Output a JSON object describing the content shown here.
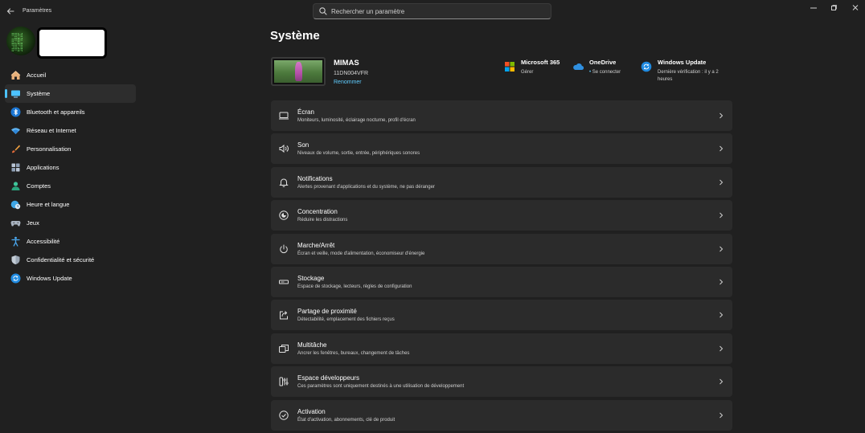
{
  "app": {
    "title": "Paramètres"
  },
  "search": {
    "placeholder": "Rechercher un paramètre"
  },
  "nav": {
    "items": [
      {
        "label": "Accueil",
        "icon": "home-icon",
        "active": false
      },
      {
        "label": "Système",
        "icon": "monitor-icon",
        "active": true
      },
      {
        "label": "Bluetooth et appareils",
        "icon": "bluetooth-icon",
        "active": false
      },
      {
        "label": "Réseau et Internet",
        "icon": "wifi-icon",
        "active": false
      },
      {
        "label": "Personnalisation",
        "icon": "brush-icon",
        "active": false
      },
      {
        "label": "Applications",
        "icon": "apps-icon",
        "active": false
      },
      {
        "label": "Comptes",
        "icon": "person-icon",
        "active": false
      },
      {
        "label": "Heure et langue",
        "icon": "globe-clock-icon",
        "active": false
      },
      {
        "label": "Jeux",
        "icon": "gamepad-icon",
        "active": false
      },
      {
        "label": "Accessibilité",
        "icon": "accessibility-icon",
        "active": false
      },
      {
        "label": "Confidentialité et sécurité",
        "icon": "shield-icon",
        "active": false
      },
      {
        "label": "Windows Update",
        "icon": "update-icon",
        "active": false
      }
    ]
  },
  "main": {
    "title": "Système",
    "device": {
      "name": "MIMAS",
      "model": "11DN004VFR",
      "rename_label": "Renommer"
    },
    "tiles": [
      {
        "title": "Microsoft 365",
        "subtitle": "Gérer",
        "icon": "microsoft-365-icon"
      },
      {
        "title": "OneDrive",
        "subtitle_dot": "•",
        "subtitle": "Se connecter",
        "icon": "onedrive-icon"
      },
      {
        "title": "Windows Update",
        "subtitle": "Dernière vérification : il y a 2",
        "subtitle2": "heures",
        "icon": "windows-update-icon"
      }
    ],
    "rows": [
      {
        "title": "Écran",
        "desc": "Moniteurs, luminosité, éclairage nocturne, profil d'écran",
        "icon": "display-icon"
      },
      {
        "title": "Son",
        "desc": "Niveaux de volume, sortie, entrée, périphériques sonores",
        "icon": "speaker-icon"
      },
      {
        "title": "Notifications",
        "desc": "Alertes provenant d'applications et du système, ne pas déranger",
        "icon": "bell-icon"
      },
      {
        "title": "Concentration",
        "desc": "Réduire les distractions",
        "icon": "focus-icon"
      },
      {
        "title": "Marche/Arrêt",
        "desc": "Écran et veille, mode d'alimentation, économiseur d'énergie",
        "icon": "power-icon"
      },
      {
        "title": "Stockage",
        "desc": "Espace de stockage, lecteurs, règles de configuration",
        "icon": "storage-icon"
      },
      {
        "title": "Partage de proximité",
        "desc": "Détectabilité, emplacement des fichiers reçus",
        "icon": "share-icon"
      },
      {
        "title": "Multitâche",
        "desc": "Ancrer les fenêtres, bureaux, changement de tâches",
        "icon": "multitask-icon"
      },
      {
        "title": "Espace développeurs",
        "desc": "Ces paramètres sont uniquement destinés à une utilisation de développement",
        "icon": "developer-icon"
      },
      {
        "title": "Activation",
        "desc": "État d'activation, abonnements, clé de produit",
        "icon": "activation-icon"
      }
    ]
  },
  "colors": {
    "accent": "#4cc2ff",
    "link": "#60cdff",
    "background": "#202020",
    "card": "#2b2b2b"
  }
}
